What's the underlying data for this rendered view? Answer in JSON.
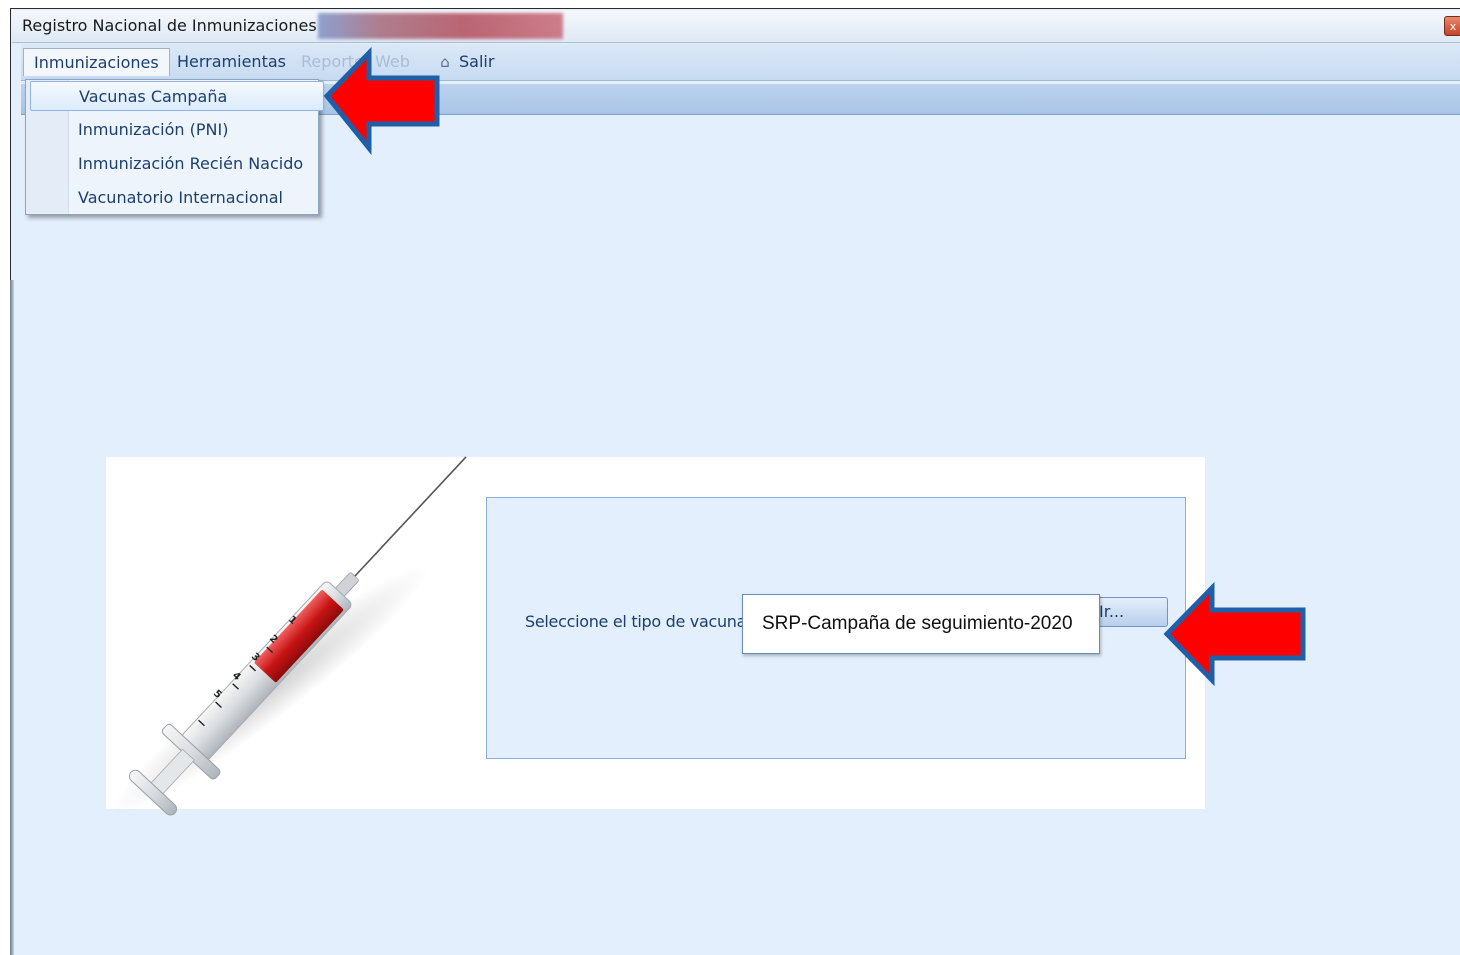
{
  "window": {
    "title": "Registro Nacional de Inmunizaciones",
    "close_glyph": "x"
  },
  "menubar": {
    "items": [
      {
        "label": "Inmunizaciones",
        "state": "active"
      },
      {
        "label": "Herramientas",
        "state": "normal"
      },
      {
        "label": "Reportes",
        "state": "disabled"
      },
      {
        "label": "Web",
        "state": "disabled"
      },
      {
        "label": "Salir",
        "state": "normal",
        "icon": "home-icon"
      }
    ]
  },
  "dropdown": {
    "items": [
      {
        "label": "Vacunas Campaña",
        "highlighted": true
      },
      {
        "label": "Inmunización (PNI)",
        "highlighted": false
      },
      {
        "label": "Inmunización Recién Nacido",
        "highlighted": false
      },
      {
        "label": "Vacunatorio Internacional",
        "highlighted": false
      }
    ]
  },
  "form": {
    "select_label": "Seleccione el tipo de vacuna",
    "selected_vaccine": "SRP-Campaña de seguimiento-2020",
    "go_button_label": "Ir..."
  },
  "annotations": {
    "arrow_color": "#ff0000",
    "arrow_border_color": "#1f5fa8"
  },
  "illustration": {
    "icon": "syringe-icon",
    "scale_marks": [
      "1",
      "2",
      "3",
      "4",
      "5"
    ]
  }
}
